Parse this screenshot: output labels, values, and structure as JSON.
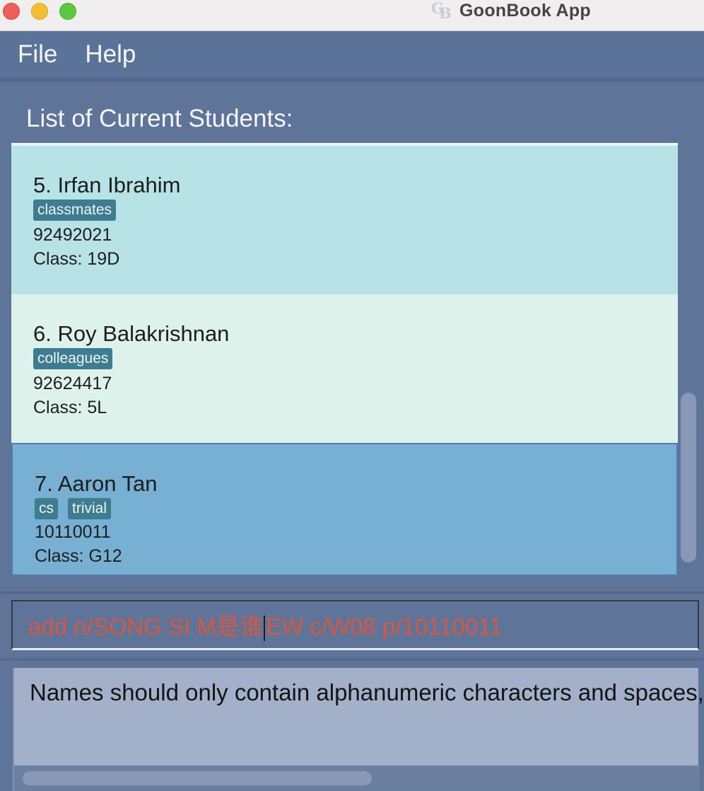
{
  "window": {
    "title": "GoonBook App",
    "logo_letters": [
      "G",
      "B"
    ]
  },
  "menu": {
    "file_label": "File",
    "help_label": "Help"
  },
  "list": {
    "heading": "List of Current Students:",
    "students": [
      {
        "index_name": "5. Irfan Ibrahim",
        "tags": [
          "classmates"
        ],
        "phone": "92492021",
        "class": "Class: 19D"
      },
      {
        "index_name": "6. Roy Balakrishnan",
        "tags": [
          "colleagues"
        ],
        "phone": "92624417",
        "class": "Class: 5L"
      },
      {
        "index_name": "7. Aaron Tan",
        "tags": [
          "cs",
          "trivial"
        ],
        "phone": "10110011",
        "class": "Class: G12"
      }
    ]
  },
  "command": {
    "text_before_caret": "add n/SONG SI M是谁",
    "text_after_caret": "EW c/W08 p/10110011"
  },
  "result": {
    "message": "Names should only contain alphanumeric characters and spaces,"
  },
  "colors": {
    "command_error_text": "#d9573e",
    "selected_card": "#78b0d4",
    "tag": "#3e7d8f"
  }
}
